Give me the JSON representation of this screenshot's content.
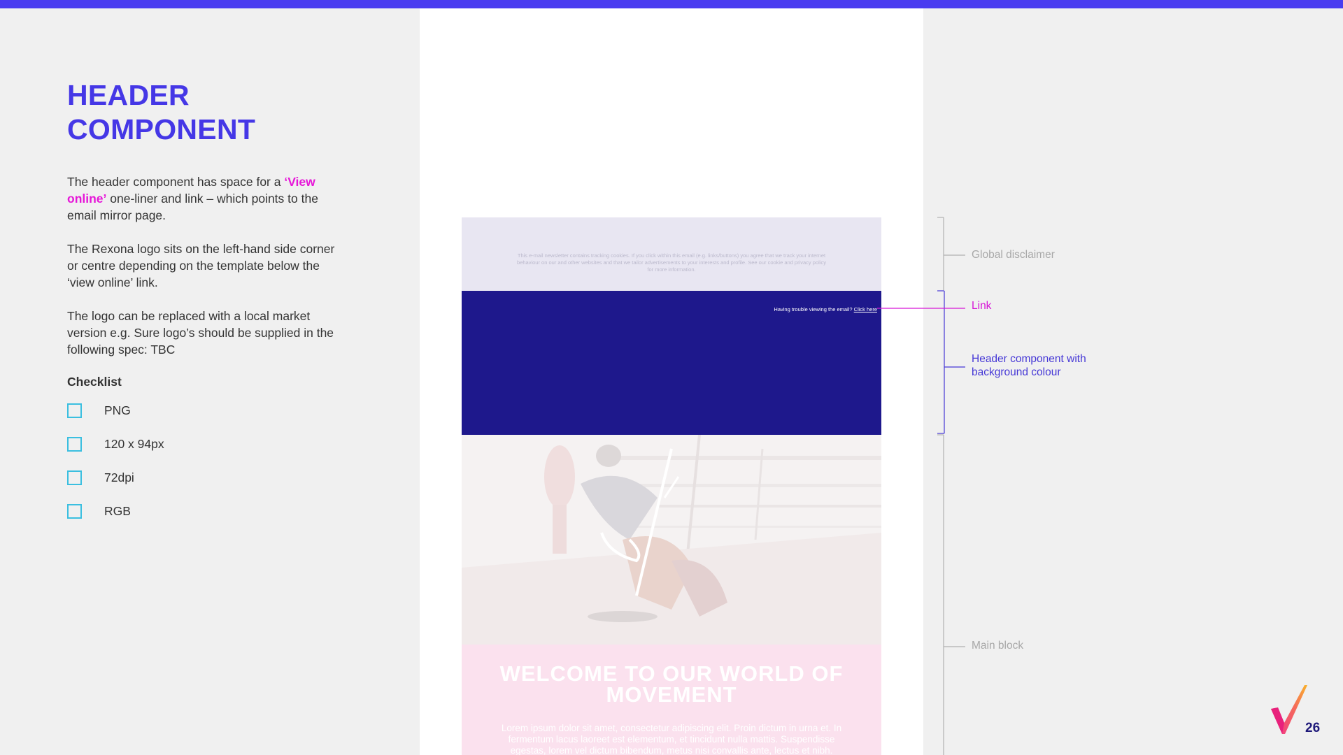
{
  "colors": {
    "accent": "#4a3cf0",
    "title": "#4537e6",
    "highlight": "#e616d8",
    "checkbox": "#3bbfe0",
    "header_bg": "#1e188c",
    "disclaimer_bg": "#e8e6f2",
    "welcome_bg": "#fbe1ee"
  },
  "left": {
    "title_line1": "HEADER",
    "title_line2": "COMPONENT",
    "para1_prefix": "The header component has space for a ",
    "para1_highlight": "‘View online’",
    "para1_suffix": " one-liner and link – which points to the email mirror page.",
    "para2": "The Rexona logo sits on the left-hand side corner or centre depending on the template below the ‘view online’ link.",
    "para3": "The logo can be replaced with a local market version e.g. Sure logo’s should be supplied in the following spec: TBC",
    "checklist_title": "Checklist",
    "checklist": [
      "PNG",
      "120 x 94px",
      "72dpi",
      "RGB"
    ]
  },
  "email": {
    "disclaimer": "This e-mail newsletter contains tracking cookies. If you click within this email (e.g. links/buttons) you agree that we track your internet behaviour on our and other websites and that we tailor advertisements to your interests and profile. See our cookie and privacy policy for more information.",
    "trouble_text": "Having trouble viewing the email?",
    "trouble_link": "Click here",
    "welcome_title": "WELCOME TO OUR WORLD OF MOVEMENT",
    "welcome_body": "Lorem ipsum dolor sit amet, consectetur adipiscing elit. Proin dictum in urna et. In fermentum lacus laoreet est elementum, et tincidunt nulla mattis. Suspendisse egestas, lorem vel dictum bibendum, metus nisi convallis ante, lectus et nibh."
  },
  "annotations": {
    "global_disclaimer": "Global disclaimer",
    "link": "Link",
    "header_line1": "Header component with",
    "header_line2": "background colour",
    "main_block": "Main block"
  },
  "page_number": "26"
}
